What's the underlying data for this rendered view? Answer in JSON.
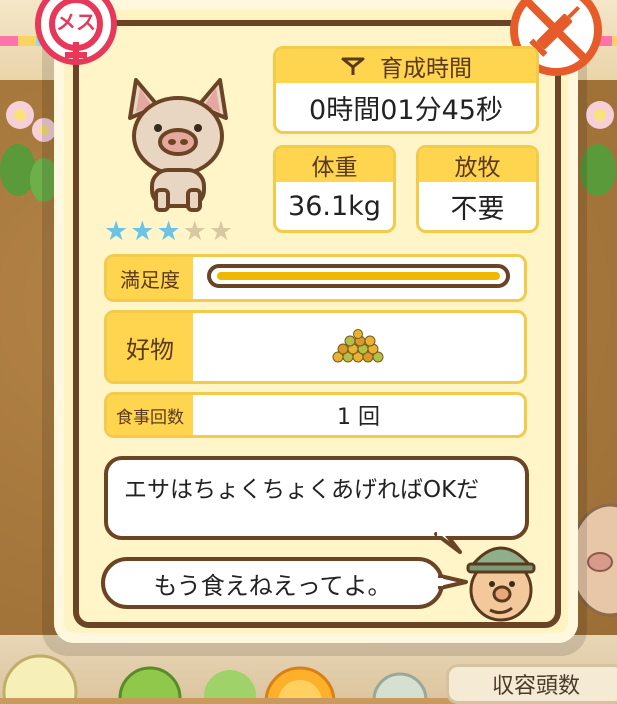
{
  "gender_badge": {
    "label": "メス",
    "color": "#e8385a"
  },
  "injection_badge": {
    "icon": "no-syringe-icon",
    "color": "#e65b2a"
  },
  "pig": {
    "icon": "pig-icon",
    "stars_filled": 3,
    "stars_total": 5
  },
  "growth_time": {
    "label": "育成時間",
    "value": "0時間01分45秒",
    "icon": "timer-icon"
  },
  "weight": {
    "label": "体重",
    "value": "36.1kg"
  },
  "grazing": {
    "label": "放牧",
    "value": "不要"
  },
  "satisfaction": {
    "label": "満足度",
    "level": 1.0,
    "bar_color": "#f0b800"
  },
  "favorite": {
    "label": "好物",
    "icon": "feed-pellets-icon"
  },
  "meals": {
    "label": "食事回数",
    "value": "1 回"
  },
  "speech": {
    "line1": "エサはちょくちょくあげればOKだ",
    "line2": "もう食えねえってよ。"
  },
  "farmer": {
    "icon": "farmer-face-icon"
  },
  "bottom": {
    "capacity_label": "収容頭数"
  },
  "colors": {
    "accent_yellow": "#ffd44f",
    "border_brown": "#6b4325",
    "panel_bg": "#fff5c9",
    "star_blue": "#6bc3e8"
  }
}
